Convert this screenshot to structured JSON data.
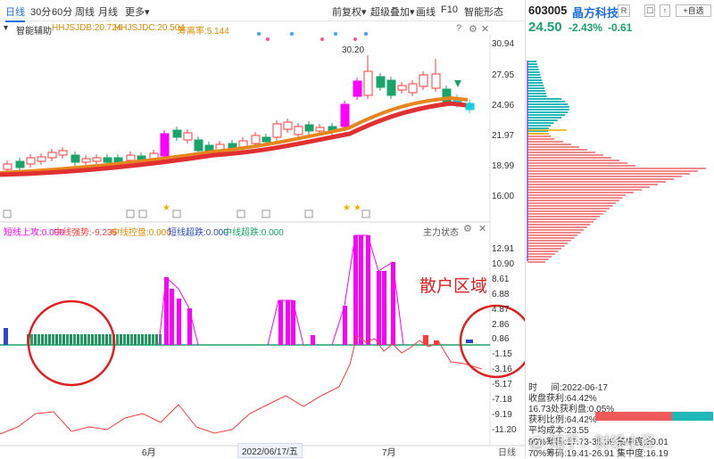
{
  "toolbar": {
    "tabs": [
      "日线",
      "30分",
      "60分",
      "周线",
      "月线",
      "更多"
    ],
    "active_tab": "日线",
    "more_caret": "▾",
    "right_buttons": [
      "前复权▾",
      "超级叠加▾",
      "画线",
      "F10",
      "智能形态"
    ]
  },
  "indicators": {
    "name": "智能辅助",
    "jdb": "HHJSJDB:20.724",
    "jdc": "HHJSJDC:20.504",
    "lsr": "筹离率:5.144",
    "sub_labels": [
      "短线上攻:0.000",
      "中线强势:-9.235",
      "中线控盘:0.000",
      "短线超跌:0.000",
      "中线超跌:0.000"
    ],
    "sub_label_colors": [
      "#ff00ff",
      "#ff3b3b",
      "#e08a00",
      "#2a48c8",
      "#1aa36a"
    ],
    "status_label": "主力状态"
  },
  "main_axis": {
    "ticks": [
      "30.94",
      "27.95",
      "24.96",
      "21.97",
      "18.99",
      "16.00"
    ],
    "high_marker": "30.20"
  },
  "sub_axis": {
    "ticks": [
      "12.91",
      "10.90",
      "8.61",
      "6.88",
      "4.87",
      "2.86",
      "0.86",
      "-1.15",
      "-3.16",
      "-5.17",
      "-7.18",
      "-9.19",
      "-11.20"
    ]
  },
  "annotation": {
    "text": "散户区域"
  },
  "x_axis": {
    "left_month": "6月",
    "date_cursor": "2022/06/17/五",
    "right_month": "7月",
    "period": "日线"
  },
  "stock": {
    "code": "603005",
    "name": "晶方科技",
    "r_button": "R",
    "price": "24.50",
    "change_pct": "-2.43%",
    "change_abs": "-0.61",
    "watch_button": "+自选"
  },
  "chip_info": {
    "time_label": "时",
    "time_value": "间:2022-06-17",
    "profit_ratio": "收盘获利:64.42%",
    "profit_at": "16.73处获利盘:0.05%",
    "profit_proportion_label": "获利比例:64.42%",
    "avg_cost": "平均成本:23.55",
    "cost_90": "90%筹码:17.73-35.59  集中度:30.01",
    "cost_70": "70%筹码:19.41-26.91  集中度:16.19",
    "watermark": "@ 知乎：财经小泽"
  },
  "colors": {
    "up": "#ff3b3b",
    "down": "#1aa36a",
    "magenta": "#ff00ff",
    "teal": "#1fb9b9",
    "accent": "#1d6fe0"
  }
}
